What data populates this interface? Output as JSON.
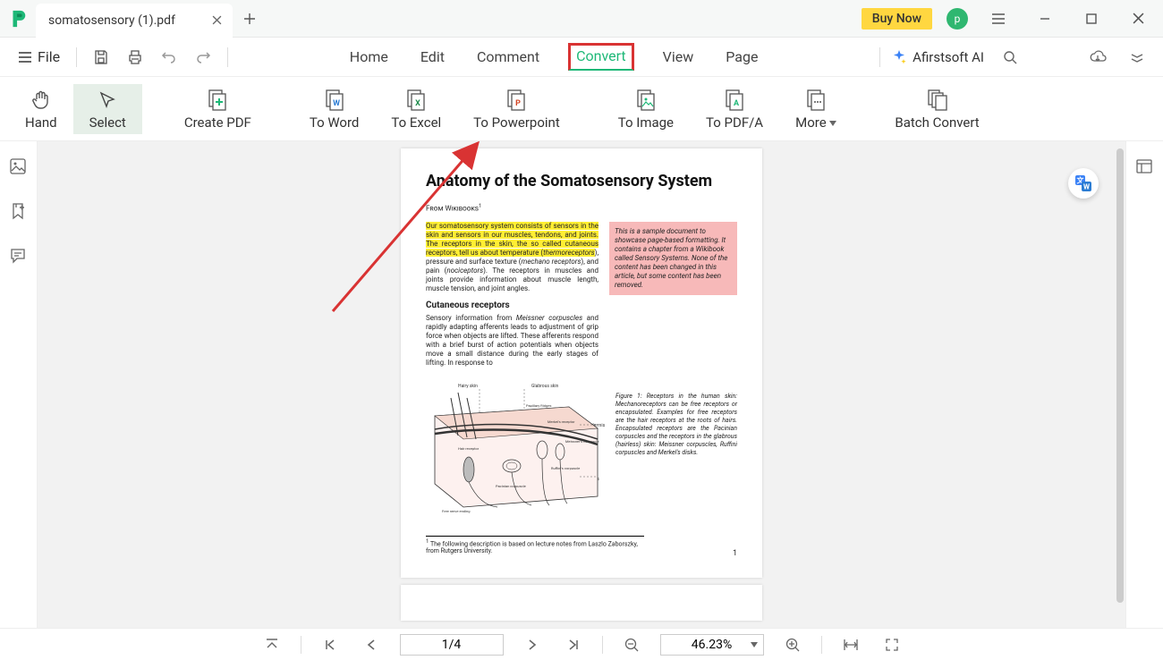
{
  "titlebar": {
    "tab_title": "somatosensory (1).pdf",
    "buy_now": "Buy Now",
    "avatar_letter": "p"
  },
  "toolbar": {
    "file_label": "File",
    "menu": {
      "home": "Home",
      "edit": "Edit",
      "comment": "Comment",
      "convert": "Convert",
      "view": "View",
      "page": "Page"
    },
    "ai_label": "Afirstsoft AI"
  },
  "ribbon": {
    "hand": "Hand",
    "select": "Select",
    "create_pdf": "Create PDF",
    "to_word": "To Word",
    "to_excel": "To Excel",
    "to_powerpoint": "To Powerpoint",
    "to_image": "To Image",
    "to_pdfa": "To PDF/A",
    "more": "More",
    "batch": "Batch Convert"
  },
  "document": {
    "title": "Anatomy of the Somatosensory System",
    "from": "From Wikibooks",
    "highlighted": "Our somatosensory system consists of sensors in the skin and sensors in our muscles, tendons, and joints. The receptors in the skin, the so called cutaneous receptors, tell us about temperature (",
    "hl_italic1": "thermoreceptors",
    "after_hl": "), pressure and surface texture (",
    "ital2": "mechano receptors",
    "after2": "), and pain (",
    "ital3": "nociceptors",
    "after3": "). The receptors in muscles and joints provide information about muscle length, muscle tension, and joint angles.",
    "sidebox": "This is a sample document to showcase page-based formatting. It contains a chapter from a Wikibook called Sensory Systems. None of the content has been changed in this article, but some content has been removed.",
    "sec_cutaneous": "Cutaneous receptors",
    "para2a": "Sensory information from ",
    "para2i": "Meissner corpuscles",
    "para2b": " and rapidly adapting afferents leads to adjustment of grip force when objects are lifted. These afferents respond with a brief burst of action potentials when objects move a small distance during the early stages of lifting. In response to",
    "fig_caption_lead": "Figure 1:",
    "fig_caption": " Receptors in the human skin: Mechanoreceptors can be free receptors or encapsulated. Examples for free receptors are the hair receptors at the roots of hairs. Encapsulated receptors are the Pacinian corpuscles and the receptors in the glabrous (hairless) skin: Meissner corpuscles, Ruffini corpuscles and Merkel's disks.",
    "footnote": "The following description is based on lecture notes from Laszlo Zaborszky, from Rutgers University.",
    "page_number": "1"
  },
  "statusbar": {
    "page_indicator": "1/4",
    "zoom": "46.23%"
  }
}
